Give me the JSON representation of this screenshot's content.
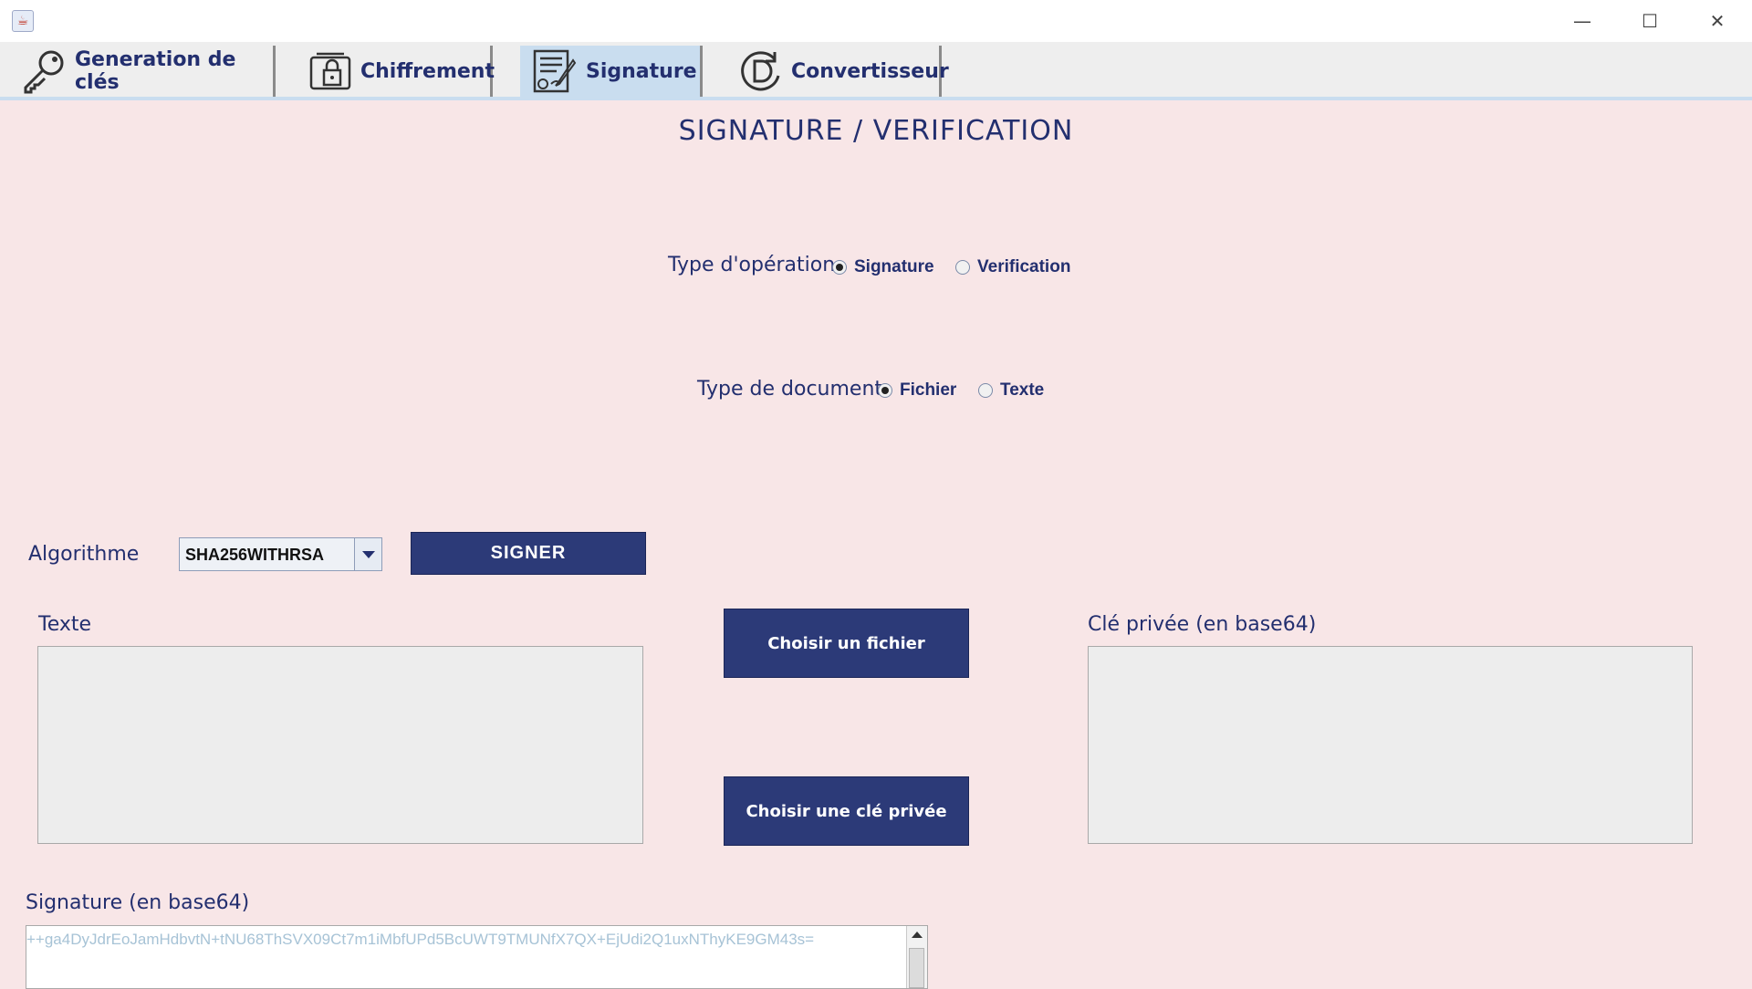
{
  "window": {
    "min_glyph": "—",
    "max_glyph": "☐",
    "close_glyph": "✕"
  },
  "tabs": [
    {
      "label": "Generation de clés",
      "icon": "key-icon",
      "active": false
    },
    {
      "label": "Chiffrement",
      "icon": "lock-icon",
      "active": false
    },
    {
      "label": "Signature",
      "icon": "signature-document-icon",
      "active": true
    },
    {
      "label": "Convertisseur",
      "icon": "convert-icon",
      "active": false
    }
  ],
  "heading": "SIGNATURE / VERIFICATION",
  "operation": {
    "label": "Type d'opération",
    "options": [
      "Signature",
      "Verification"
    ],
    "selected": "Signature"
  },
  "document": {
    "label": "Type de document",
    "options": [
      "Fichier",
      "Texte"
    ],
    "selected": "Fichier"
  },
  "algorithm": {
    "label": "Algorithme",
    "value": "SHA256WITHRSA"
  },
  "buttons": {
    "sign": "SIGNER",
    "choose_file": "Choisir un fichier",
    "choose_key": "Choisir une clé privée"
  },
  "text_field": {
    "label": "Texte",
    "value": ""
  },
  "key_field": {
    "label": "Clé privée (en base64)",
    "value": ""
  },
  "signature_field": {
    "label": "Signature (en base64)",
    "value": "++ga4DyJdrEoJamHdbvtN+tNU68ThSVX09Ct7m1iMbfUPd5BcUWT9TMUNfX7QX+EjUdi2Q1uxNThyKE9GM43s="
  },
  "colors": {
    "background": "#f8e6e7",
    "accent": "#2c3a78",
    "text": "#232f6f",
    "active_tab": "#c9ddef"
  }
}
